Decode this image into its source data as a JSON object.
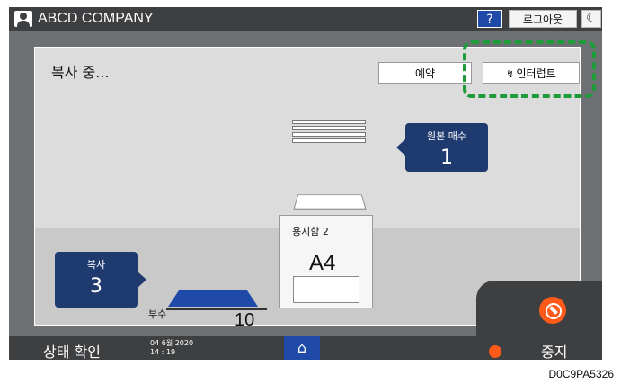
{
  "topbar": {
    "company": "ABCD COMPANY",
    "help_label": "?",
    "logout_label": "로그아웃",
    "moon_label": "☾"
  },
  "dialog": {
    "title": "복사 중...",
    "reserve_label": "예약",
    "interrupt_icon": "↯",
    "interrupt_label": "인터럽트",
    "originals_label": "원본 매수",
    "originals_value": "1",
    "tray_label": "용지함 2",
    "tray_paper_size": "A4",
    "copy_label": "복사",
    "copy_value": "3",
    "copies_label": "부수",
    "copies_value": "10"
  },
  "bottombar": {
    "status_label": "상태 확인",
    "date": "04 6월 2020",
    "time": "14 : 19",
    "home_icon": "⌂",
    "stop_label": "중지"
  },
  "caption": "D0C9PA5326"
}
